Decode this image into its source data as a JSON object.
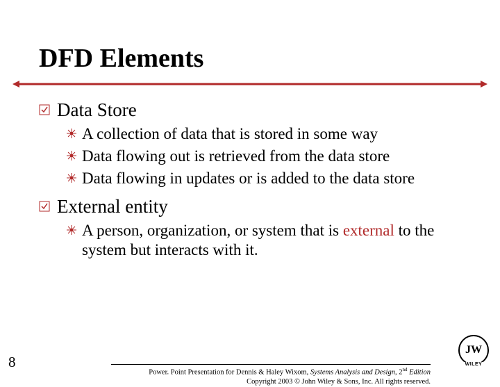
{
  "title": "DFD Elements",
  "items": [
    {
      "label": "Data Store",
      "children": [
        "A collection of data that is stored in some way",
        "Data flowing out is retrieved from the data store",
        "Data flowing in updates or is added to the data store"
      ]
    },
    {
      "label": "External entity",
      "children_html": [
        "A person, organization, or system that is <span class=\"red\">external</span> to the system but interacts with it."
      ]
    }
  ],
  "footer": {
    "line1_pre": "Power. Point Presentation for Dennis & Haley Wixom, ",
    "line1_ital": "Systems Analysis and Design, ",
    "line1_post": "2",
    "line1_sup": "nd",
    "line1_end": " Edition",
    "line2": "Copyright 2003 © John Wiley & Sons, Inc. All rights reserved."
  },
  "page_number": "8",
  "logo": {
    "monogram": "JW",
    "label": "WILEY"
  }
}
